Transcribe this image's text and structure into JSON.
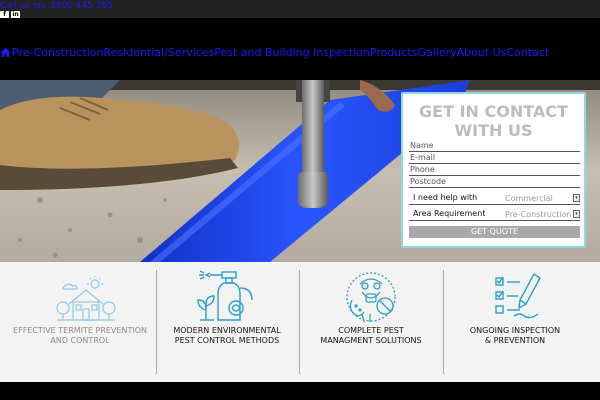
{
  "topbar": {
    "phone": "Call us on: 1800 445 785",
    "socials": [
      {
        "icon": "facebook-icon",
        "glyph": "f"
      },
      {
        "icon": "linkedin-icon",
        "glyph": "in"
      }
    ]
  },
  "nav": {
    "items": [
      {
        "label": "Pre-Construction",
        "icon": "home-icon"
      },
      {
        "label": "Residential/Services"
      },
      {
        "label": "Pest and Building Inspection"
      },
      {
        "label": "Products"
      },
      {
        "label": "Gallery"
      },
      {
        "label": "About Us"
      },
      {
        "label": "Contact"
      }
    ],
    "link_color": "#1a1aff"
  },
  "contact_form": {
    "title_line1": "GET IN CONTACT",
    "title_line2": "WITH US",
    "fields": [
      "Name",
      "E-mail",
      "Phone",
      "Postcode"
    ],
    "help_label": "I need help with",
    "help_value": "Commercial",
    "area_label": "Area Requirement",
    "area_value": "Pre-Construction",
    "button_label": "GET QUOTE",
    "border_color": "#8fd6e6"
  },
  "features": [
    {
      "line1": "EFFECTIVE TERMITE PREVENTION",
      "line2": "AND CONTROL",
      "icon": "house-icon",
      "muted": true
    },
    {
      "line1": "MODERN ENVIRONMENTAL",
      "line2": "PEST CONTROL METHODS",
      "icon": "spray-bottle-icon",
      "muted": false
    },
    {
      "line1": "COMPLETE PEST",
      "line2": "MANAGMENT SOLUTIONS",
      "icon": "gas-mask-icon",
      "muted": false
    },
    {
      "line1": "ONGOING INSPECTION",
      "line2": "& PREVENTION",
      "icon": "checklist-icon",
      "muted": false
    }
  ],
  "accent": "#1a3fd8",
  "icon_color": "#2aa0c9"
}
